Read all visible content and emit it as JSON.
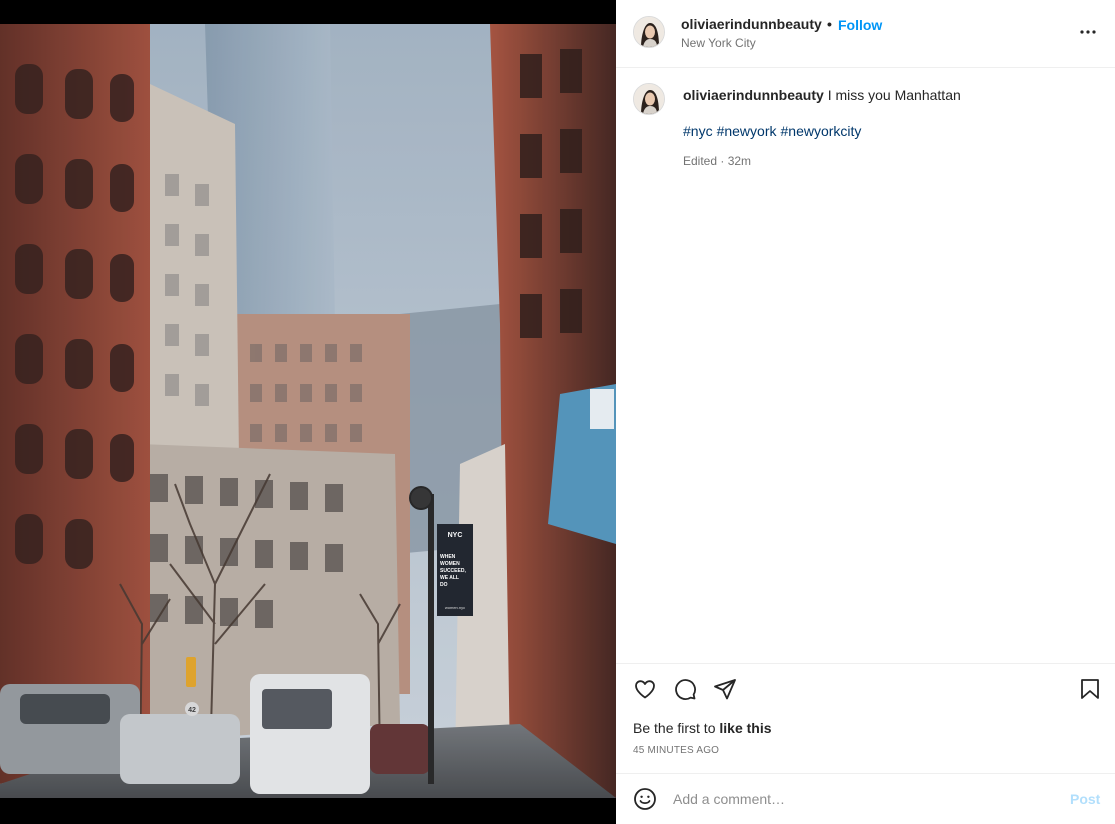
{
  "post": {
    "image_alt": "",
    "header": {
      "username": "oliviaerindunnbeauty",
      "separator": "•",
      "follow_label": "Follow",
      "location": "New York City",
      "more_icon": "more-horizontal-icon"
    },
    "caption": {
      "username": "oliviaerindunnbeauty",
      "text": "I miss you Manhattan",
      "hashtags": [
        "#nyc",
        "#newyork",
        "#newyorkcity"
      ],
      "meta": "Edited · 32m"
    },
    "actions": {
      "like_icon": "heart-icon",
      "comment_icon": "comment-icon",
      "share_icon": "paper-plane-icon",
      "save_icon": "bookmark-icon"
    },
    "likes": {
      "prefix": "Be the first to",
      "link": "like this"
    },
    "timestamp": "45 minutes ago",
    "add_comment": {
      "emoji_icon": "emoji-icon",
      "placeholder": "Add a comment…",
      "post_label": "Post"
    },
    "photo_signs": {
      "banner_top": "NYC",
      "banner_text": "WHEN WOMEN SUCCEED, WE ALL DO",
      "banner_footer": "women.nyc",
      "street_number": "42"
    }
  },
  "colors": {
    "accent": "#0095f6",
    "hashtag": "#00376b",
    "muted": "#737373",
    "post_disabled": "#b2dffc"
  }
}
